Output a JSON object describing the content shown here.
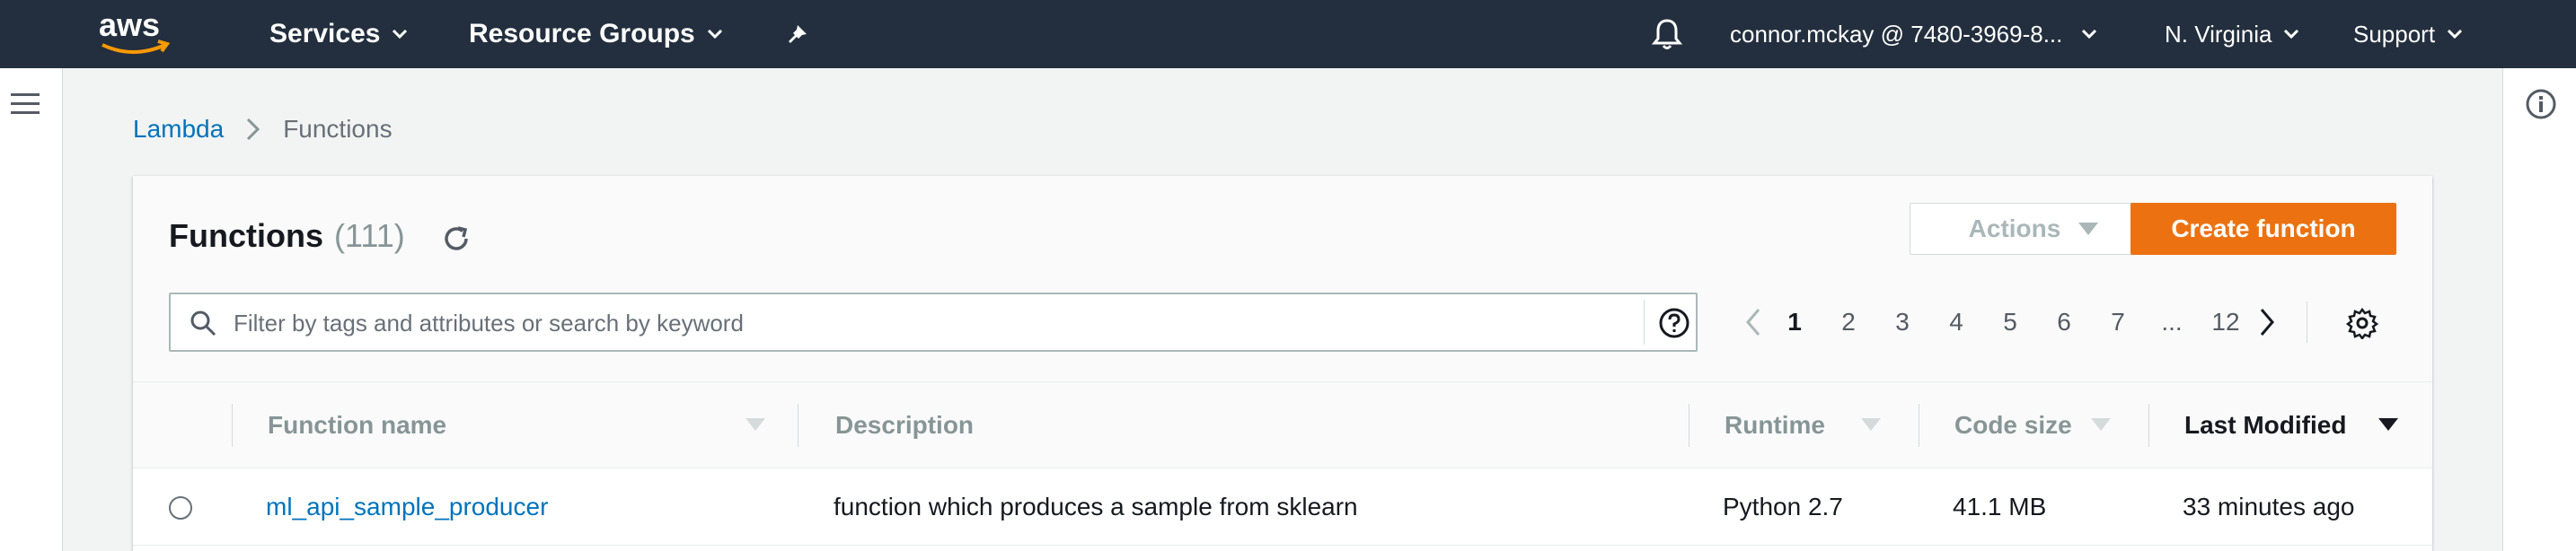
{
  "nav": {
    "logo_text": "aws",
    "services_label": "Services",
    "resource_groups_label": "Resource Groups",
    "account_label": "connor.mckay @ 7480-3969-8...",
    "region_label": "N. Virginia",
    "support_label": "Support"
  },
  "breadcrumb": {
    "parent": "Lambda",
    "current": "Functions"
  },
  "panel": {
    "title": "Functions",
    "count": "(111)",
    "actions_label": "Actions",
    "create_label": "Create function"
  },
  "search": {
    "placeholder": "Filter by tags and attributes or search by keyword",
    "value": ""
  },
  "pagination": {
    "pages": [
      "1",
      "2",
      "3",
      "4",
      "5",
      "6",
      "7",
      "...",
      "12"
    ],
    "current_page": "1"
  },
  "table": {
    "columns": {
      "function_name": "Function name",
      "description": "Description",
      "runtime": "Runtime",
      "code_size": "Code size",
      "last_modified": "Last Modified"
    },
    "rows": [
      {
        "function_name": "ml_api_sample_producer",
        "description": "function which produces a sample from sklearn",
        "runtime": "Python 2.7",
        "code_size": "41.1 MB",
        "last_modified": "33 minutes ago"
      }
    ]
  },
  "colors": {
    "nav_bg": "#232f3e",
    "accent_orange": "#ec7211",
    "link_blue": "#0073bb"
  }
}
